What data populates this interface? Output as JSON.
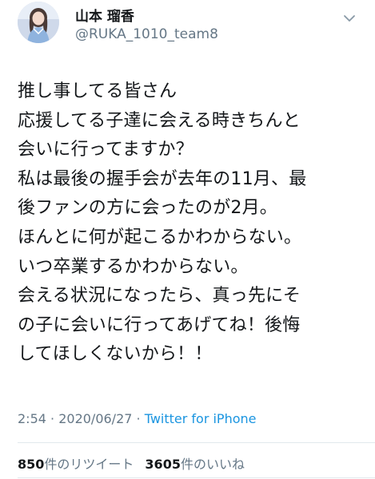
{
  "author": {
    "display_name": "山本 瑠香",
    "handle": "@RUKA_1010_team8"
  },
  "tweet": {
    "lines": [
      "推し事してる皆さん",
      "応援してる子達に会える時きちんと",
      "会いに行ってますか？",
      "私は最後の握手会が去年の11月、最",
      "後ファンの方に会ったのが2月。",
      "ほんとに何が起こるかわからない。",
      "いつ卒業するかわからない。",
      "会える状況になったら、真っ先にそ",
      "の子に会いに行ってあげてね！後悔",
      "してほしくないから！！"
    ]
  },
  "meta": {
    "time": "2:54",
    "separator1": " · ",
    "date": "2020/06/27",
    "separator2": " · ",
    "source": "Twitter for iPhone"
  },
  "stats": {
    "retweets_count": "850",
    "retweets_label": "件のリツイート",
    "likes_count": "3605",
    "likes_label": "件のいいね"
  },
  "icons": {
    "menu": "chevron-down-icon",
    "avatar": "profile-photo"
  },
  "colors": {
    "text": "#14171a",
    "secondary": "#657786",
    "link": "#1b95e0",
    "divider": "#e1e8ed"
  }
}
